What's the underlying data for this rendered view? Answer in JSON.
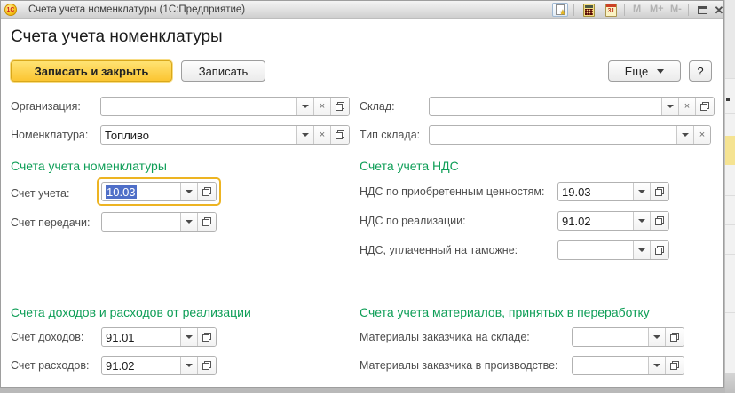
{
  "titlebar": {
    "logo_text": "1С",
    "title": "Счета учета номенклатуры  (1С:Предприятие)",
    "calendar_day": "31",
    "memory": [
      "M",
      "M+",
      "M-"
    ]
  },
  "page": {
    "title": "Счета учета номенклатуры"
  },
  "toolbar": {
    "save_and_close": "Записать и закрыть",
    "save": "Записать",
    "more": "Еще",
    "help": "?"
  },
  "general": {
    "organization": {
      "label": "Организация:",
      "value": ""
    },
    "nomenclature": {
      "label": "Номенклатура:",
      "value": "Топливо"
    },
    "warehouse": {
      "label": "Склад:",
      "value": ""
    },
    "warehouse_type": {
      "label": "Тип склада:",
      "value": ""
    }
  },
  "sections": {
    "inventory": {
      "title": "Счета учета номенклатуры",
      "account": {
        "label": "Счет учета:",
        "value": "10.03"
      },
      "transfer_account": {
        "label": "Счет передачи:",
        "value": ""
      }
    },
    "vat": {
      "title": "Счета учета НДС",
      "purchased": {
        "label": "НДС по приобретенным ценностям:",
        "value": "19.03"
      },
      "sales": {
        "label": "НДС по реализации:",
        "value": "91.02"
      },
      "customs": {
        "label": "НДС, уплаченный на таможне:",
        "value": ""
      }
    },
    "income_expense": {
      "title": "Счета доходов и расходов от реализации",
      "income": {
        "label": "Счет доходов:",
        "value": "91.01"
      },
      "expense": {
        "label": "Счет расходов:",
        "value": "91.02"
      }
    },
    "processing": {
      "title": "Счета учета материалов, принятых в переработку",
      "on_warehouse": {
        "label": "Материалы заказчика на складе:",
        "value": ""
      },
      "in_production": {
        "label": "Материалы заказчика в производстве:",
        "value": ""
      }
    }
  },
  "colors": {
    "accent_yellow": "#fbc531",
    "section_green": "#0e9e57",
    "selection_blue": "#4f6fc8",
    "focus_ring": "#edb422"
  }
}
